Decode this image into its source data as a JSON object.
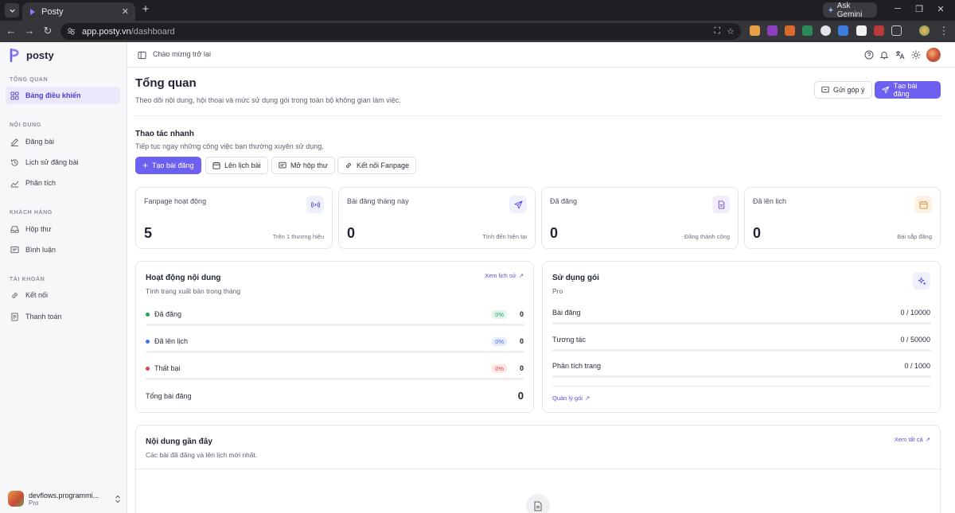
{
  "browser": {
    "tab_title": "Posty",
    "tab_close": "✕",
    "new_tab": "+",
    "gemini_label": "Ask Gemini",
    "url_host": "app.posty.vn",
    "url_path": "/dashboard"
  },
  "app": {
    "name": "posty",
    "brand_color": "#6d5ff0"
  },
  "sidebar": {
    "sections": [
      {
        "title": "TỔNG QUAN",
        "items": [
          {
            "label": "Bảng điều khiển",
            "icon": "dashboard-icon",
            "active": true
          }
        ]
      },
      {
        "title": "NỘI DUNG",
        "items": [
          {
            "label": "Đăng bài",
            "icon": "edit-icon"
          },
          {
            "label": "Lịch sử đăng bài",
            "icon": "history-icon"
          },
          {
            "label": "Phân tích",
            "icon": "chart-icon"
          }
        ]
      },
      {
        "title": "KHÁCH HÀNG",
        "items": [
          {
            "label": "Hộp thư",
            "icon": "inbox-icon"
          },
          {
            "label": "Bình luận",
            "icon": "comment-icon"
          }
        ]
      },
      {
        "title": "TÀI KHOẢN",
        "items": [
          {
            "label": "Kết nối",
            "icon": "link-icon"
          },
          {
            "label": "Thanh toán",
            "icon": "receipt-icon"
          }
        ]
      }
    ],
    "account": {
      "name": "devflows.programmi...",
      "plan": "Pro"
    }
  },
  "topbar": {
    "welcome": "Chào mừng trở lại"
  },
  "header": {
    "title": "Tổng quan",
    "subtitle": "Theo dõi nội dung, hội thoại và mức sử dụng gói trong toàn bộ không gian làm việc.",
    "feedback_button": "Gửi góp ý",
    "create_button": "Tạo bài đăng"
  },
  "quick_actions": {
    "title": "Thao tác nhanh",
    "subtitle": "Tiếp tục ngay những công việc bạn thường xuyên sử dụng.",
    "buttons": [
      "Tạo bài đăng",
      "Lên lịch bài",
      "Mở hộp thư",
      "Kết nối Fanpage"
    ]
  },
  "stats": [
    {
      "label": "Fanpage hoạt động",
      "value": "5",
      "note": "Trên 1 thương hiệu",
      "icon": "broadcast-icon",
      "bg": "#eef0fb",
      "color": "#5b4fe0"
    },
    {
      "label": "Bài đăng tháng này",
      "value": "0",
      "note": "Tính đến hiện tại",
      "icon": "send-icon",
      "bg": "#eef0fb",
      "color": "#5b4fe0"
    },
    {
      "label": "Đã đăng",
      "value": "0",
      "note": "Đăng thành công",
      "icon": "document-icon",
      "bg": "#f1edfb",
      "color": "#6d4fd8"
    },
    {
      "label": "Đã lên lịch",
      "value": "0",
      "note": "Bài sắp đăng",
      "icon": "calendar-icon",
      "bg": "#fdf1e3",
      "color": "#d98a2b"
    }
  ],
  "activity": {
    "title": "Hoạt động nội dung",
    "subtitle": "Tình trạng xuất bản trong tháng",
    "link": "Xem lịch sử",
    "rows": [
      {
        "label": "Đã đăng",
        "percent": "0%",
        "count": "0",
        "dot": "#22a45d",
        "pill_bg": "#e3f5ea",
        "pill_fg": "#22a45d"
      },
      {
        "label": "Đã lên lịch",
        "percent": "0%",
        "count": "0",
        "dot": "#3b6ff0",
        "pill_bg": "#e7ecfd",
        "pill_fg": "#3b6ff0"
      },
      {
        "label": "Thất bại",
        "percent": "0%",
        "count": "0",
        "dot": "#e04444",
        "pill_bg": "#fde6e6",
        "pill_fg": "#e04444"
      }
    ],
    "total_label": "Tổng bài đăng",
    "total_value": "0"
  },
  "usage": {
    "title": "Sử dụng gói",
    "plan": "Pro",
    "rows": [
      {
        "label": "Bài đăng",
        "value": "0 / 10000"
      },
      {
        "label": "Tương tác",
        "value": "0 / 50000"
      },
      {
        "label": "Phân tích trang",
        "value": "0 / 1000"
      }
    ],
    "link": "Quản lý gói"
  },
  "recent": {
    "title": "Nội dung gần đây",
    "subtitle": "Các bài đã đăng và lên lịch mới nhất.",
    "link": "Xem tất cả"
  }
}
